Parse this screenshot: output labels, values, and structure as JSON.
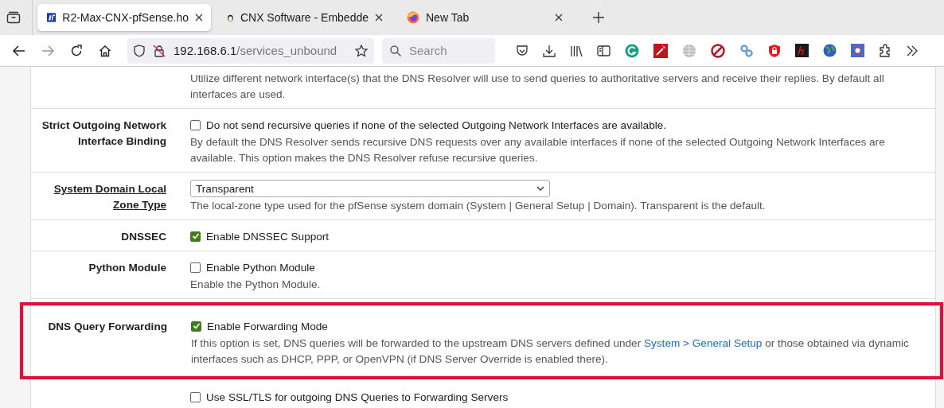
{
  "tabs": [
    {
      "title": "R2-Max-CNX-pfSense.ho",
      "selected": true
    },
    {
      "title": "CNX Software - Embedde",
      "selected": false
    },
    {
      "title": "New Tab",
      "selected": false
    }
  ],
  "address": {
    "host": "192.168.6.1",
    "path": "/services_unbound"
  },
  "search": {
    "placeholder": "Search"
  },
  "rows": [
    {
      "kind": "text",
      "description": "Utilize different network interface(s) that the DNS Resolver will use to send queries to authoritative servers and receive their replies. By default all interfaces are used.",
      "highlighted": false
    },
    {
      "kind": "checkbox",
      "label": "Strict Outgoing Network Interface Binding",
      "checked": false,
      "option": "Do not send recursive queries if none of the selected Outgoing Network Interfaces are available.",
      "description": "By default the DNS Resolver sends recursive DNS requests over any available interfaces if none of the selected Outgoing Network Interfaces are available. This option makes the DNS Resolver refuse recursive queries.",
      "highlighted": false
    },
    {
      "kind": "select",
      "label": "System Domain Local Zone Type",
      "label_link": true,
      "value": "Transparent",
      "description": "The local-zone type used for the pfSense system domain (System | General Setup | Domain). Transparent is the default.",
      "highlighted": false
    },
    {
      "kind": "checkbox",
      "label": "DNSSEC",
      "checked": true,
      "option": "Enable DNSSEC Support",
      "highlighted": false
    },
    {
      "kind": "checkbox",
      "label": "Python Module",
      "checked": false,
      "option": "Enable Python Module",
      "description": "Enable the Python Module.",
      "highlighted": false
    },
    {
      "kind": "checkbox",
      "label": "DNS Query Forwarding",
      "checked": true,
      "option": "Enable Forwarding Mode",
      "description": "If this option is set, DNS queries will be forwarded to the upstream DNS servers defined under ",
      "link": "System > General Setup",
      "description_after": " or those obtained via dynamic interfaces such as DHCP, PPP, or OpenVPN (if DNS Server Override is enabled there).",
      "highlighted": true
    },
    {
      "kind": "checkbox",
      "checked": false,
      "option": "Use SSL/TLS for outgoing DNS Queries to Forwarding Servers",
      "highlighted": false
    }
  ]
}
